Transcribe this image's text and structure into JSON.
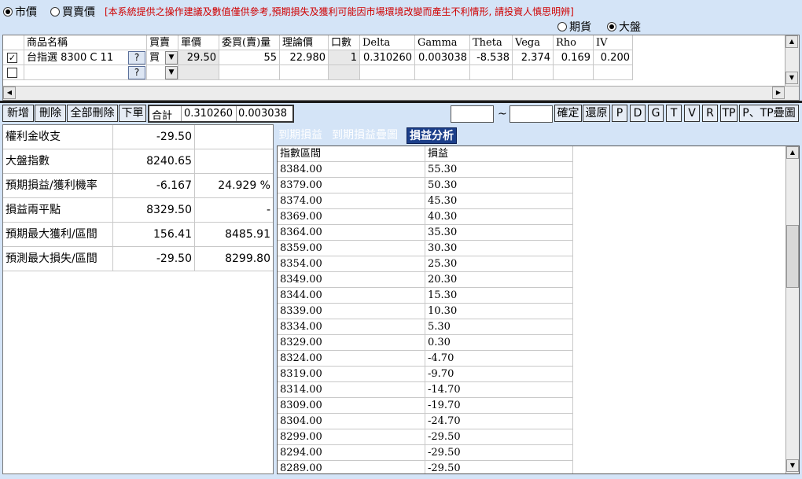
{
  "top": {
    "price_mode": [
      {
        "label": "市價",
        "selected": true
      },
      {
        "label": "買賣價",
        "selected": false
      }
    ],
    "disclaimer": "[本系統提供之操作建議及數值僅供參考,預期損失及獲利可能因市場環境改變而產生不利情形, 請投資人慎思明辨]",
    "base_mode": [
      {
        "label": "期貨",
        "selected": false
      },
      {
        "label": "大盤",
        "selected": true
      }
    ]
  },
  "grid": {
    "headers": [
      "商品名稱",
      "買賣",
      "單價",
      "委買(賣)量",
      "理論價",
      "口數",
      "Delta",
      "Gamma",
      "Theta",
      "Vega",
      "Rho",
      "IV"
    ],
    "rows": [
      {
        "checked": true,
        "name": "台指選  8300 C 11",
        "help": "?",
        "side": "買",
        "price": "29.50",
        "qty": "55",
        "theory": "22.980",
        "lots": "1",
        "delta": "0.310260",
        "gamma": "0.003038",
        "theta": "-8.538",
        "vega": "2.374",
        "rho": "0.169",
        "iv": "0.200"
      },
      {
        "checked": false,
        "name": "",
        "help": "?",
        "side": "",
        "price": "",
        "qty": "",
        "theory": "",
        "lots": "",
        "delta": "",
        "gamma": "",
        "theta": "",
        "vega": "",
        "rho": "",
        "iv": ""
      }
    ]
  },
  "toolbar": {
    "add": "新增",
    "delete": "刪除",
    "delete_all": "全部刪除",
    "order": "下單",
    "sum_label": "合計",
    "sum_delta": "0.310260",
    "sum_gamma": "0.003038",
    "range_sep": "~",
    "confirm": "確定",
    "restore": "還原",
    "btn_p": "P",
    "btn_d": "D",
    "btn_g": "G",
    "btn_t": "T",
    "btn_v": "V",
    "btn_r": "R",
    "btn_tp": "TP",
    "btn_ptp": "P、TP疊圖"
  },
  "summary": [
    {
      "label": "權利金收支",
      "value": "-29.50",
      "extra": ""
    },
    {
      "label": "大盤指數",
      "value": "8240.65",
      "extra": ""
    },
    {
      "label": "預期損益/獲利機率",
      "value": "-6.167",
      "extra": "24.929 %"
    },
    {
      "label": "損益兩平點",
      "value": "8329.50",
      "extra": "-"
    },
    {
      "label": "預期最大獲利/區間",
      "value": "156.41",
      "extra": "8485.91"
    },
    {
      "label": "預測最大損失/區間",
      "value": "-29.50",
      "extra": "8299.80"
    }
  ],
  "tabs": [
    {
      "label": "到期損益",
      "active": false
    },
    {
      "label": "到期損益疊圖",
      "active": false
    },
    {
      "label": "損益分析",
      "active": true
    }
  ],
  "pl_table": {
    "headers": [
      "指數區間",
      "損益"
    ],
    "rows": [
      [
        "8384.00",
        "55.30"
      ],
      [
        "8379.00",
        "50.30"
      ],
      [
        "8374.00",
        "45.30"
      ],
      [
        "8369.00",
        "40.30"
      ],
      [
        "8364.00",
        "35.30"
      ],
      [
        "8359.00",
        "30.30"
      ],
      [
        "8354.00",
        "25.30"
      ],
      [
        "8349.00",
        "20.30"
      ],
      [
        "8344.00",
        "15.30"
      ],
      [
        "8339.00",
        "10.30"
      ],
      [
        "8334.00",
        "5.30"
      ],
      [
        "8329.00",
        "0.30"
      ],
      [
        "8324.00",
        "-4.70"
      ],
      [
        "8319.00",
        "-9.70"
      ],
      [
        "8314.00",
        "-14.70"
      ],
      [
        "8309.00",
        "-19.70"
      ],
      [
        "8304.00",
        "-24.70"
      ],
      [
        "8299.00",
        "-29.50"
      ],
      [
        "8294.00",
        "-29.50"
      ],
      [
        "8289.00",
        "-29.50"
      ]
    ]
  }
}
